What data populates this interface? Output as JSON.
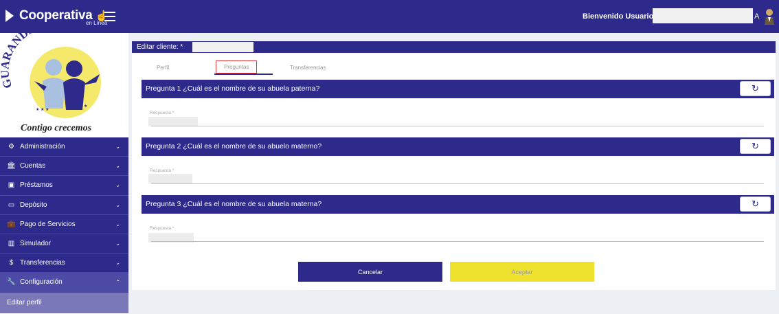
{
  "topbar": {
    "brand": "Cooperativa",
    "brand_sub": "en Línea",
    "welcome": "Bienvenido Usuario:",
    "user_tail": "A"
  },
  "sidebar": {
    "logo_text": "GUARANDA Ltda.",
    "slogan": "Contigo crecemos",
    "items": [
      {
        "label": "Administración",
        "icon": "gear-icon"
      },
      {
        "label": "Cuentas",
        "icon": "bank-icon"
      },
      {
        "label": "Préstamos",
        "icon": "loan-icon"
      },
      {
        "label": "Depósito",
        "icon": "card-icon"
      },
      {
        "label": "Pago de Servicios",
        "icon": "briefcase-icon"
      },
      {
        "label": "Simulador",
        "icon": "chart-icon"
      },
      {
        "label": "Transferencias",
        "icon": "dollar-icon"
      },
      {
        "label": "Configuración",
        "icon": "wrench-icon"
      }
    ],
    "subitem": "Editar perfil"
  },
  "main": {
    "header": "Editar cliente: *",
    "tabs": [
      "Perfil",
      "Preguntas",
      "Transferencias"
    ],
    "questions": [
      {
        "title": "Pregunta 1 ¿Cuál es el nombre de su abuela paterna?",
        "label": "Respuesta *"
      },
      {
        "title": "Pregunta 2 ¿Cuál es el nombre de su abuelo materno?",
        "label": "Respuesta *"
      },
      {
        "title": "Pregunta 3 ¿Cuál es el nombre de su abuela materna?",
        "label": "Respuesta *"
      }
    ],
    "cancel": "Cancelar",
    "accept": "Aceptar"
  },
  "colors": {
    "primary": "#2d2a8c",
    "accent": "#eee22f",
    "subnav": "#7a78b8"
  }
}
